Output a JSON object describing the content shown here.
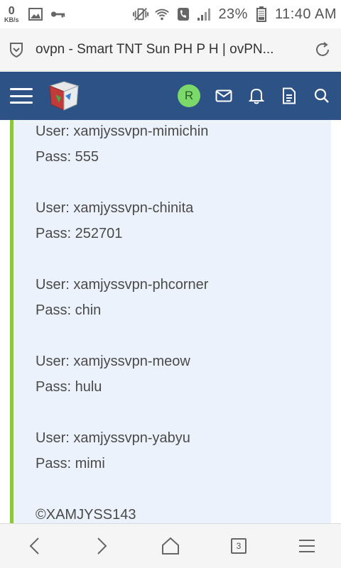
{
  "status_bar": {
    "data_rate_value": "0",
    "data_rate_unit": "KB/s",
    "battery_percent": "23%",
    "time": "11:40 AM"
  },
  "address_bar": {
    "page_title": "ovpn - Smart TNT Sun PH P H | ovPN..."
  },
  "header": {
    "avatar_letter": "R"
  },
  "post": {
    "credentials": [
      {
        "user": "User: xamjyssvpn-mimichin",
        "pass": "Pass: 555"
      },
      {
        "user": "User: xamjyssvpn-chinita",
        "pass": "Pass: 252701"
      },
      {
        "user": "User: xamjyssvpn-phcorner",
        "pass": "Pass: chin"
      },
      {
        "user": "User: xamjyssvpn-meow",
        "pass": "Pass: hulu"
      },
      {
        "user": "User: xamjyssvpn-yabyu",
        "pass": "Pass: mimi"
      }
    ],
    "signature": "©XAMJYSS143"
  },
  "bottom_nav": {
    "tab_count": "3"
  },
  "colors": {
    "header_bg": "#2d5286",
    "quote_bg": "#ecf2fb",
    "quote_border": "#8ec63f",
    "avatar_bg": "#7bd96a"
  }
}
